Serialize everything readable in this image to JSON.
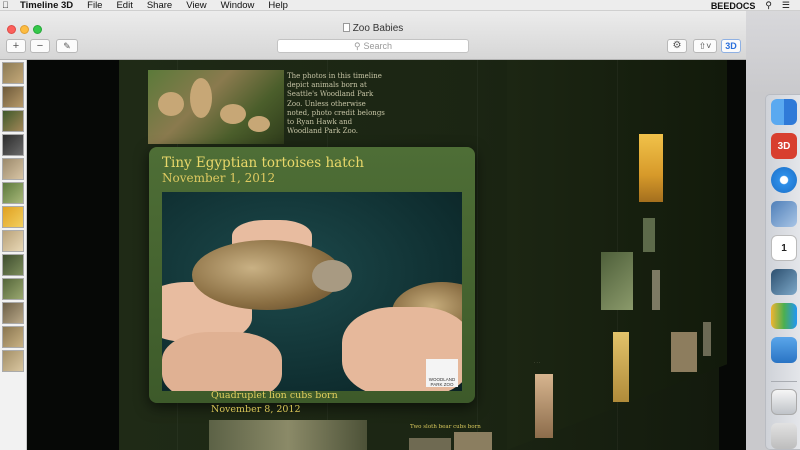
{
  "menubar": {
    "app_name": "Timeline 3D",
    "items": [
      "File",
      "Edit",
      "Share",
      "View",
      "Window",
      "Help"
    ],
    "status_label": "BEEDOCS"
  },
  "window": {
    "title": "Zoo Babies",
    "search_placeholder": "Search",
    "mode_label": "3D"
  },
  "timeline": {
    "intro_text": "The photos in this timeline depict animals born at Seattle's Woodland Park Zoo. Unless otherwise noted, photo credit belongs to Ryan Hawk and Woodland Park Zoo.",
    "main_event": {
      "title": "Tiny Egyptian tortoises hatch",
      "date": "November 1, 2012",
      "photo_credit": "WOODLAND PARK ZOO"
    },
    "next_event": {
      "title": "Quadruplet lion cubs born",
      "date": "November 8, 2012"
    },
    "far_event": {
      "title": "Two sloth bear cubs born"
    }
  },
  "icons": {
    "apple": "apple-icon",
    "search": "search-icon",
    "control_center": "control-center-icon",
    "settings": "gear-icon",
    "share": "share-icon"
  },
  "colors": {
    "card_title": "#e9d86a",
    "card_bg": "#4e6e36",
    "accent_3d": "#2a6fdb"
  }
}
